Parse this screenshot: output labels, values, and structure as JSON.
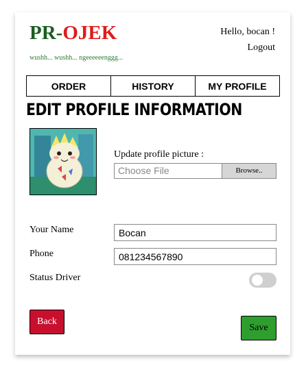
{
  "brand": {
    "pr": "PR",
    "dash": "-",
    "ojek": "OJEK",
    "tagline": "wushh... wushh... ngeeeeeenggg..."
  },
  "header": {
    "greeting": "Hello, bocan !",
    "logout_label": "Logout"
  },
  "nav": {
    "tabs": [
      {
        "label": "ORDER"
      },
      {
        "label": "HISTORY"
      },
      {
        "label": "MY PROFILE"
      }
    ]
  },
  "page": {
    "title": "EDIT PROFILE INFORMATION"
  },
  "profile_picture": {
    "label": "Update profile picture :",
    "file_placeholder": "Choose File",
    "browse_label": "Browse.."
  },
  "form": {
    "name_label": "Your Name",
    "name_value": "Bocan",
    "phone_label": "Phone",
    "phone_value": "081234567890",
    "status_label": "Status Driver",
    "status_driver": false
  },
  "actions": {
    "back_label": "Back",
    "save_label": "Save"
  },
  "colors": {
    "brand_green": "#1b5e20",
    "brand_red": "#e01b1b",
    "back_button": "#c8102e",
    "save_button": "#2e9e2e"
  }
}
